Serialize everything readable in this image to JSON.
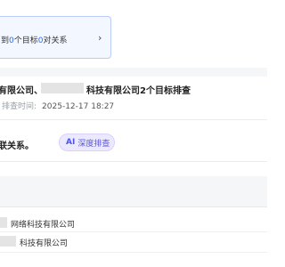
{
  "summary": {
    "prefix": "到",
    "target_count": "0",
    "middle": "个目标",
    "relation_count": "0",
    "suffix": "对关系",
    "chevron": "›"
  },
  "result": {
    "title_part1": "有限公司、",
    "title_part2": "科技有限公司2个目标排查",
    "time_label": "排查时间:",
    "time_value": "2025-12-17 18:27"
  },
  "relation": {
    "text": "联关系。",
    "ai_badge": "AI",
    "ai_label": "深度排查"
  },
  "companies": [
    {
      "name": "网络科技有限公司"
    },
    {
      "name": "科技有限公司"
    }
  ],
  "colors": {
    "accent": "#2f6bec",
    "ai_purple": "#5a55d8",
    "ai_bg": "#ece9ff"
  }
}
